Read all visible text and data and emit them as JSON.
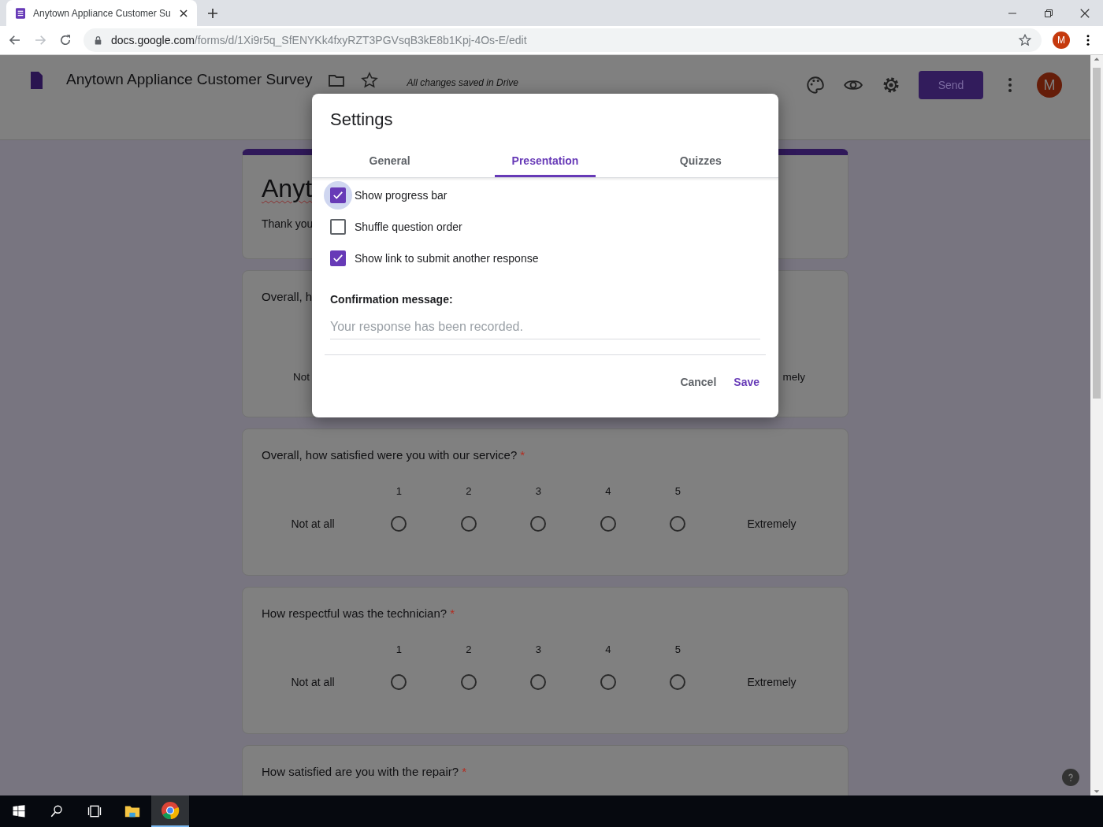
{
  "browser": {
    "tab_title": "Anytown Appliance Customer Su",
    "url_host": "docs.google.com",
    "url_path": "/forms/d/1Xi9r5q_SfENYKk4fxyRZT3PGVsqB3kE8b1Kpj-4Os-E/edit",
    "profile": "M"
  },
  "form_header": {
    "title": "Anytown Appliance Customer Survey",
    "status": "All changes saved in Drive",
    "send": "Send",
    "avatar": "M"
  },
  "form": {
    "title": "Anyt",
    "description": "Thank you",
    "questions": [
      {
        "text": "Overall, h",
        "low_label": "Not",
        "high_label": "mely"
      },
      {
        "text": "Overall, how satisfied were you with our service?",
        "asterisk": "*",
        "scale": [
          {
            "label": "1",
            "selected": false
          },
          {
            "label": "2",
            "selected": false
          },
          {
            "label": "3",
            "selected": false
          },
          {
            "label": "4",
            "selected": false
          },
          {
            "label": "5",
            "selected": false
          }
        ],
        "low_label": "Not at all",
        "high_label": "Extremely"
      },
      {
        "text": "How respectful was the technician?",
        "asterisk": "*",
        "scale": [
          {
            "label": "1",
            "selected": false
          },
          {
            "label": "2",
            "selected": false
          },
          {
            "label": "3",
            "selected": false
          },
          {
            "label": "4",
            "selected": false
          },
          {
            "label": "5",
            "selected": false
          }
        ],
        "low_label": "Not at all",
        "high_label": "Extremely"
      },
      {
        "text": "How satisfied are you with the repair?",
        "asterisk": "*"
      }
    ]
  },
  "dialog": {
    "title": "Settings",
    "tabs": [
      {
        "label": "General",
        "selected": false
      },
      {
        "label": "Presentation",
        "selected": true
      },
      {
        "label": "Quizzes",
        "selected": false
      }
    ],
    "options": [
      {
        "label": "Show progress bar",
        "checked": true,
        "focused": true
      },
      {
        "label": "Shuffle question order",
        "checked": false,
        "focused": false
      },
      {
        "label": "Show link to submit another response",
        "checked": true,
        "focused": false
      }
    ],
    "confirmation_label": "Confirmation message:",
    "confirmation_placeholder": "Your response has been recorded.",
    "buttons": [
      {
        "label": "Cancel",
        "kind": "secondary"
      },
      {
        "label": "Save",
        "kind": "primary"
      }
    ]
  }
}
